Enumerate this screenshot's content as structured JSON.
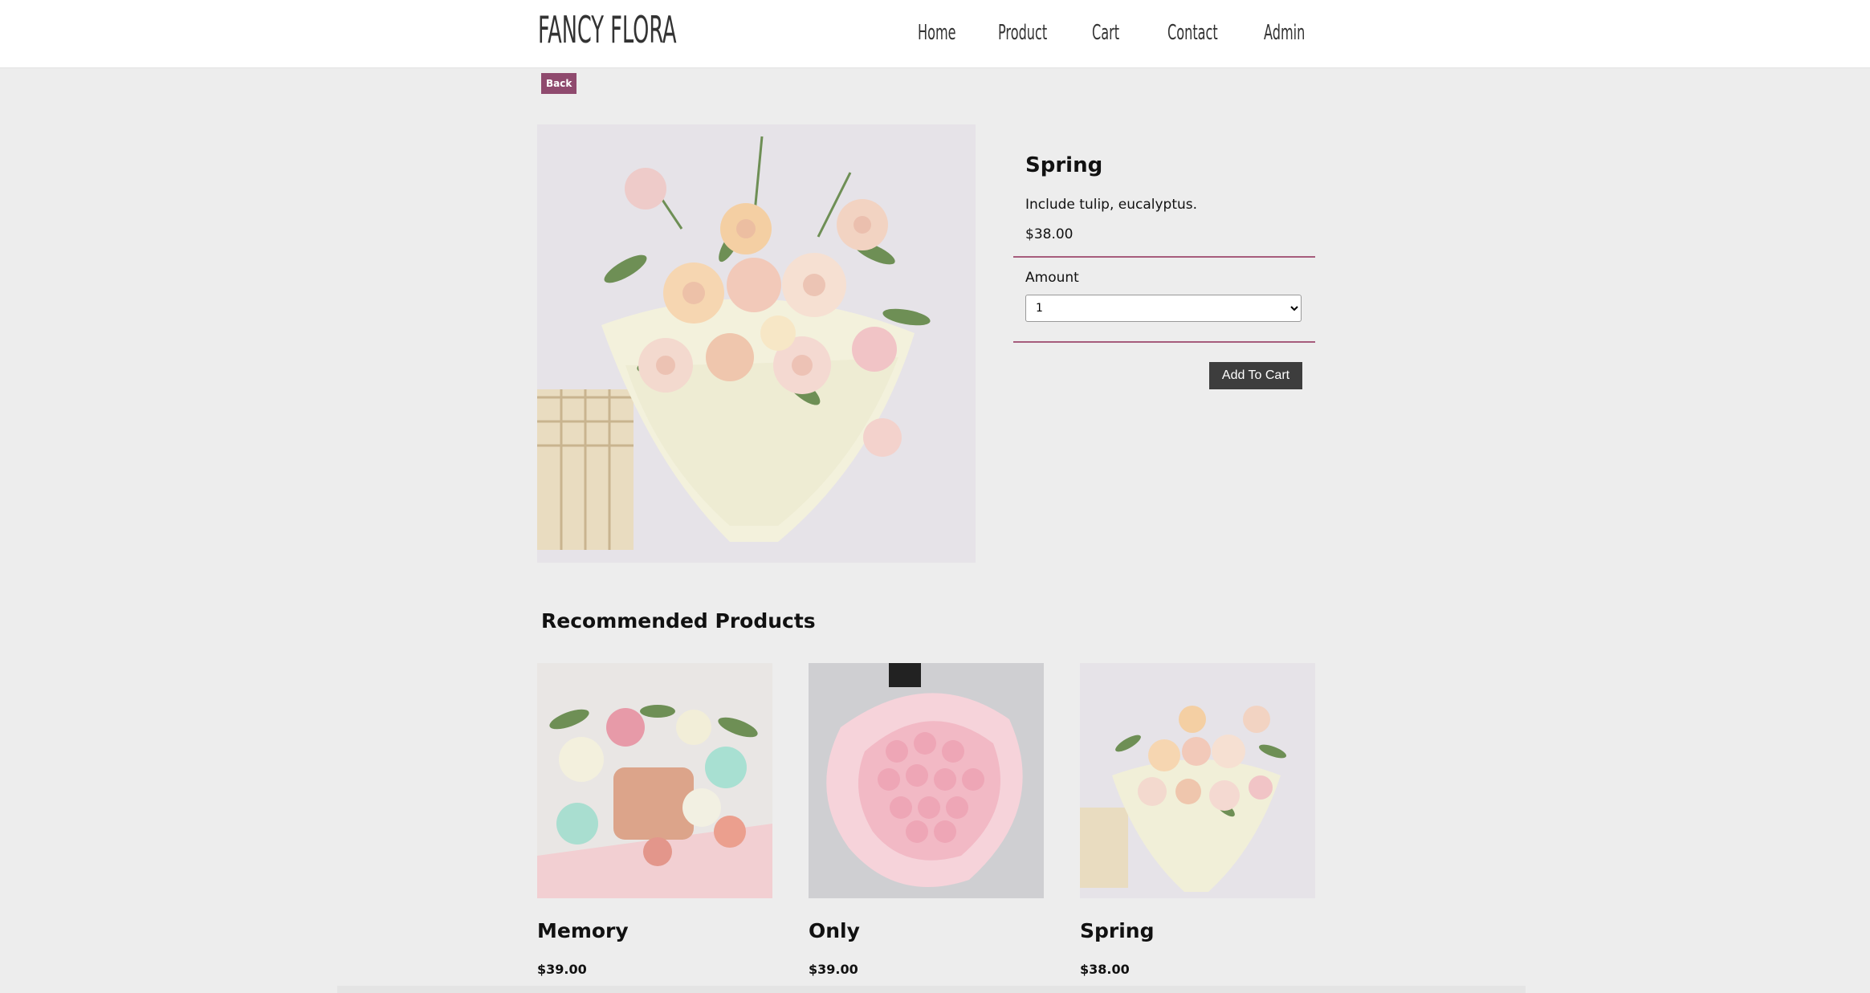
{
  "header": {
    "logo": "FANCY FLORA",
    "nav": [
      "Home",
      "Product",
      "Cart",
      "Contact",
      "Admin"
    ]
  },
  "back_label": "Back",
  "product": {
    "title": "Spring",
    "description": "Include tulip, eucalyptus.",
    "price": "$38.00",
    "amount_label": "Amount",
    "amount_value": "1",
    "add_to_cart_label": "Add To Cart"
  },
  "recommended": {
    "heading": "Recommended Products",
    "items": [
      {
        "name": "Memory",
        "price": "$39.00"
      },
      {
        "name": "Only",
        "price": "$39.00"
      },
      {
        "name": "Spring",
        "price": "$38.00"
      }
    ]
  },
  "colors": {
    "accent": "#8f4a6e",
    "rule": "#a65c7c",
    "button": "#3d3d3d",
    "background": "#ededed"
  }
}
